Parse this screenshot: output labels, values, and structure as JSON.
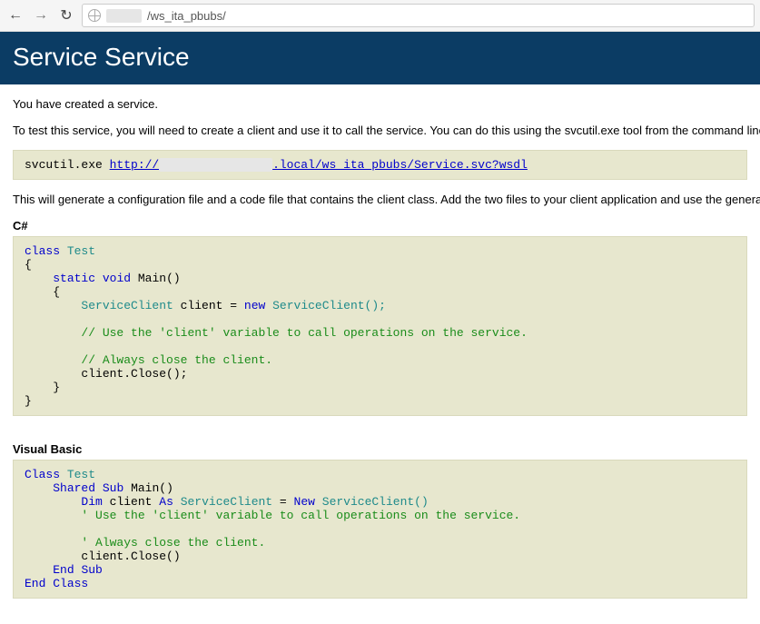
{
  "addressbar": {
    "path": "/ws_ita_pbubs/"
  },
  "header": {
    "title": "Service Service"
  },
  "body": {
    "intro": "You have created a service.",
    "test_line": "To test this service, you will need to create a client and use it to call the service. You can do this using the svcutil.exe tool from the command line",
    "svcutil_cmd": "svcutil.exe ",
    "svcutil_link_prefix": "http://",
    "svcutil_link_suffix": ".local/ws_ita_pbubs/Service.svc?wsdl",
    "gen_line": "This will generate a configuration file and a code file that contains the client class. Add the two files to your client application and use the genera"
  },
  "csharp": {
    "label": "C#",
    "kw_class": "class",
    "name_Test": "Test",
    "brace_open": "{",
    "kw_static": "static",
    "kw_void": "void",
    "name_Main": "Main()",
    "type_sc": "ServiceClient",
    "var_client": "client",
    "op_eq": "=",
    "kw_new": "new",
    "ctor": "ServiceClient();",
    "comment1": "// Use the 'client' variable to call operations on the service.",
    "comment2": "// Always close the client.",
    "close_stmt": "client.Close();",
    "brace_close": "}"
  },
  "vb": {
    "label": "Visual Basic",
    "kw_Class": "Class",
    "name_Test": "Test",
    "kw_Shared": "Shared",
    "kw_Sub": "Sub",
    "name_Main": "Main()",
    "kw_Dim": "Dim",
    "var_client": "client",
    "kw_As": "As",
    "type_sc": "ServiceClient",
    "op_eq": "=",
    "kw_New": "New",
    "ctor": "ServiceClient()",
    "comment1": "' Use the 'client' variable to call operations on the service.",
    "comment2": "' Always close the client.",
    "close_stmt": "client.Close()",
    "kw_End": "End",
    "kw_Sub2": "Sub",
    "kw_Class2": "Class"
  }
}
